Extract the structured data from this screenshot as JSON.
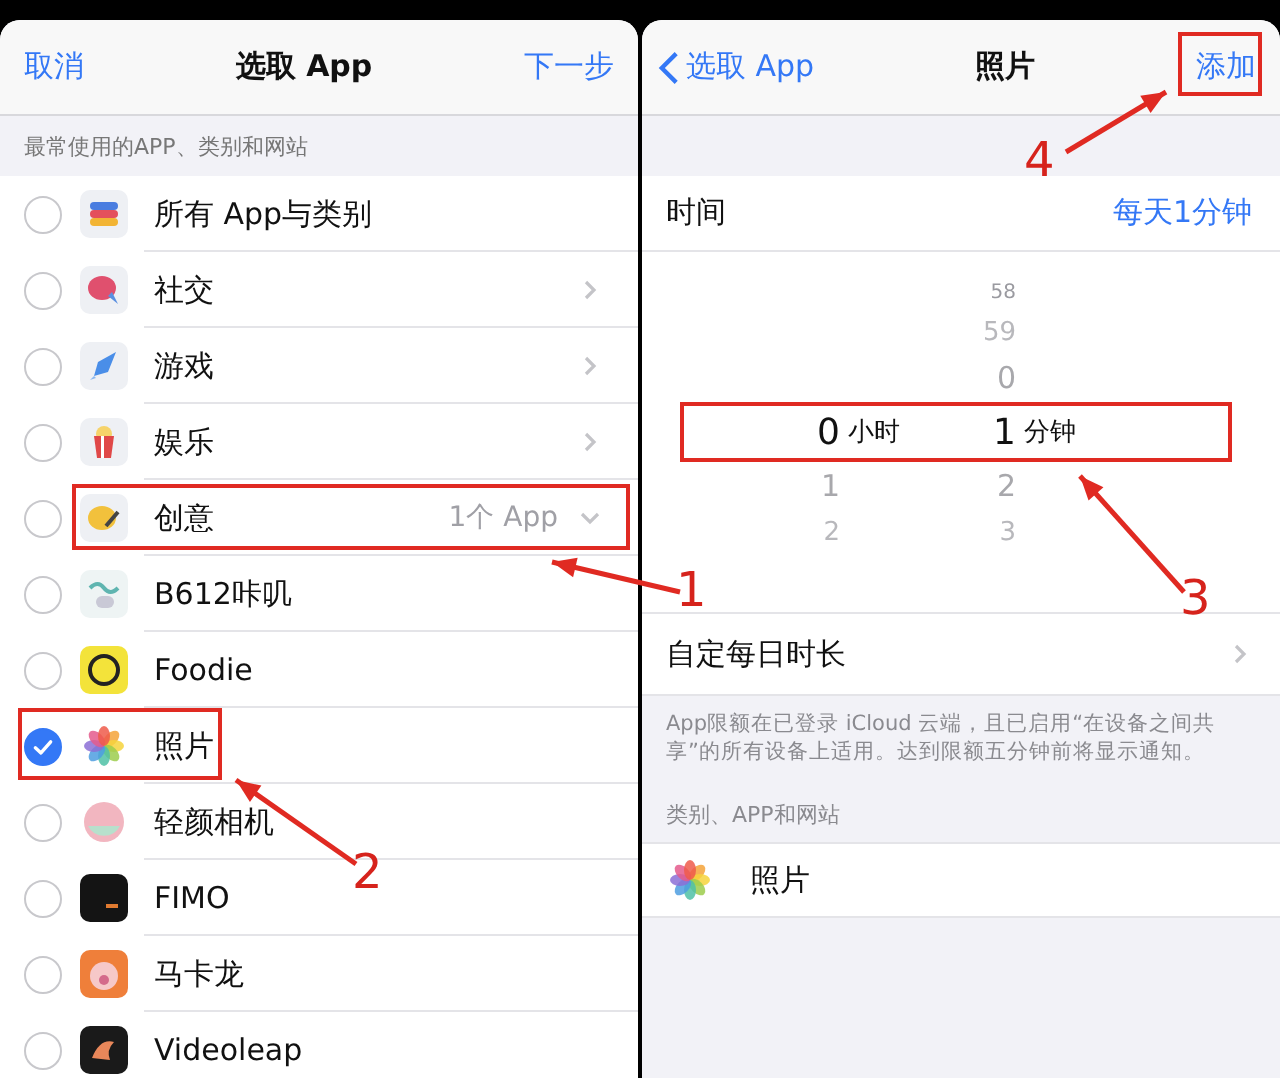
{
  "left": {
    "nav": {
      "cancel": "取消",
      "title": "选取 App",
      "next": "下一步"
    },
    "section_header": "最常使用的APP、类别和网站",
    "rows": [
      {
        "kind": "all",
        "label": "所有 App与类别",
        "selected": false
      },
      {
        "kind": "category",
        "label": "社交",
        "selected": false,
        "expanded": false
      },
      {
        "kind": "category",
        "label": "游戏",
        "selected": false,
        "expanded": false
      },
      {
        "kind": "category",
        "label": "娱乐",
        "selected": false,
        "expanded": false
      },
      {
        "kind": "category",
        "label": "创意",
        "selected": false,
        "expanded": true,
        "detail": "1个 App"
      },
      {
        "kind": "app",
        "label": "B612咔叽",
        "selected": false
      },
      {
        "kind": "app",
        "label": "Foodie",
        "selected": false
      },
      {
        "kind": "app",
        "label": "照片",
        "selected": true
      },
      {
        "kind": "app",
        "label": "轻颜相机",
        "selected": false
      },
      {
        "kind": "app",
        "label": "FIMO",
        "selected": false
      },
      {
        "kind": "app",
        "label": "马卡龙",
        "selected": false
      },
      {
        "kind": "app",
        "label": "Videoleap",
        "selected": false
      }
    ]
  },
  "right": {
    "nav": {
      "back": "选取 App",
      "title": "照片",
      "action": "添加"
    },
    "time_row": {
      "label": "时间",
      "value": "每天1分钟"
    },
    "picker": {
      "columns": [
        {
          "value": "0",
          "unit": "小时",
          "below": [
            "1",
            "2"
          ]
        },
        {
          "above": [
            "58",
            "59",
            "0"
          ],
          "value": "1",
          "unit": "分钟",
          "below": [
            "2",
            "3"
          ]
        }
      ]
    },
    "custom_row": {
      "label": "自定每日时长"
    },
    "note": "App限额在已登录 iCloud 云端，且已启用“在设备之间共享”的所有设备上适用。达到限额五分钟前将显示通知。",
    "section_header": "类别、APP和网站",
    "apps": [
      {
        "label": "照片"
      }
    ]
  },
  "annotations": [
    {
      "label": "1"
    },
    {
      "label": "2"
    },
    {
      "label": "3"
    },
    {
      "label": "4"
    }
  ]
}
